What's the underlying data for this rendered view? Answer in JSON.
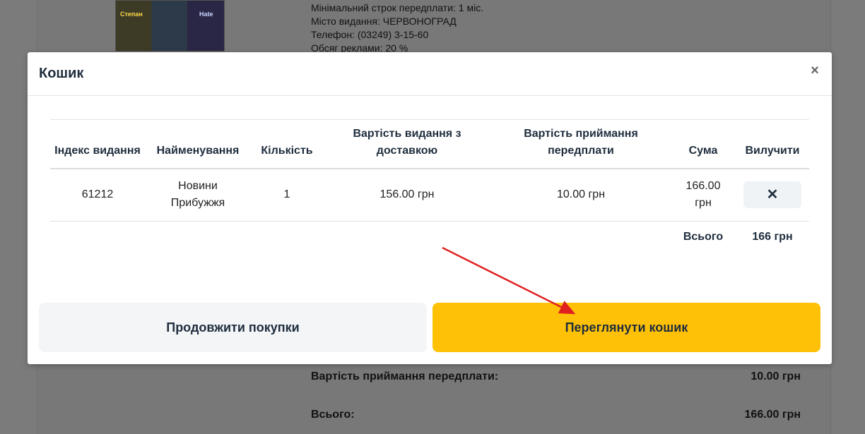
{
  "background": {
    "thumbnail_texts": [
      "Степан",
      "Hate"
    ],
    "info_lines": [
      "Мінімальний строк передплати: 1 міс.",
      "Місто видання: ЧЕРВОНОГРАД",
      "Телефон: (03249) 3-15-60",
      "Обсяг реклами: 20 %"
    ],
    "subscription_fee_label": "Вартість приймання передплати:",
    "subscription_fee_value": "10.00 грн",
    "total_label": "Всього:",
    "total_value": "166.00 грн"
  },
  "modal": {
    "title": "Кошик",
    "close_symbol": "×",
    "columns": {
      "index": "Індекс видання",
      "name": "Найменування",
      "quantity": "Кількість",
      "cost_delivery": "Вартість видання з доставкою",
      "cost_acceptance": "Вартість приймання передплати",
      "sum": "Сума",
      "remove": "Вилучити"
    },
    "items": [
      {
        "index": "61212",
        "name": "Новини Прибужжя",
        "quantity": "1",
        "cost_delivery": "156.00 грн",
        "cost_acceptance": "10.00 грн",
        "sum": "166.00 грн",
        "remove_symbol": "✕"
      }
    ],
    "total_label": "Всього",
    "total_value": "166 грн",
    "continue_button": "Продовжити покупки",
    "view_cart_button": "Переглянути кошик"
  },
  "colors": {
    "accent": "#ffc107",
    "arrow": "#e02020",
    "overlay": "#7b7b7b"
  }
}
